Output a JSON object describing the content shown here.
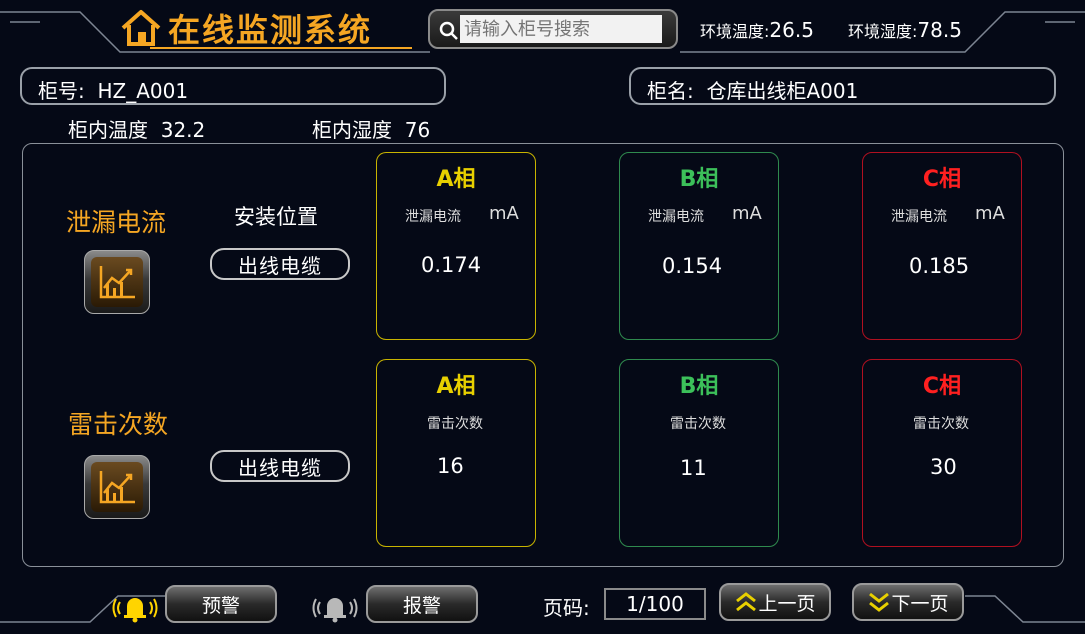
{
  "header": {
    "title": "在线监测系统",
    "search": {
      "placeholder": "请输入柜号搜索",
      "value": ""
    },
    "env_temp": {
      "label": "环境温度:",
      "value": "26.5"
    },
    "env_humidity": {
      "label": "环境湿度:",
      "value": "78.5"
    }
  },
  "cabinet": {
    "id_label": "柜号:",
    "id_value": "HZ_A001",
    "name_label": "柜名:",
    "name_value": "仓库出线柜A001",
    "inner_temp_label": "柜内温度",
    "inner_temp_value": "32.2",
    "inner_humidity_label": "柜内湿度",
    "inner_humidity_value": "76"
  },
  "sections": [
    {
      "title": "泄漏电流",
      "install_label": "安装位置",
      "location": "出线电缆",
      "phases": [
        {
          "name": "A相",
          "metric": "泄漏电流",
          "unit": "mA",
          "value": "0.174"
        },
        {
          "name": "B相",
          "metric": "泄漏电流",
          "unit": "mA",
          "value": "0.154"
        },
        {
          "name": "C相",
          "metric": "泄漏电流",
          "unit": "mA",
          "value": "0.185"
        }
      ]
    },
    {
      "title": "雷击次数",
      "location": "出线电缆",
      "phases": [
        {
          "name": "A相",
          "metric": "雷击次数",
          "value": "16"
        },
        {
          "name": "B相",
          "metric": "雷击次数",
          "value": "11"
        },
        {
          "name": "C相",
          "metric": "雷击次数",
          "value": "30"
        }
      ]
    }
  ],
  "footer": {
    "warning_label": "预警",
    "alarm_label": "报警",
    "page_label": "页码:",
    "page_value": "1/100",
    "prev_label": "上一页",
    "next_label": "下一页"
  },
  "colors": {
    "accent": "#f5a623",
    "phase_a": "#c8b400",
    "phase_b": "#2f8a4e",
    "phase_c": "#b01020",
    "phase_a_text": "#e8d000",
    "phase_b_text": "#3cc05a",
    "phase_c_text": "#ff2020"
  },
  "icons": [
    "home-icon",
    "search-icon",
    "chart-icon",
    "bell-icon",
    "chevron-up-icon",
    "chevron-down-icon"
  ]
}
